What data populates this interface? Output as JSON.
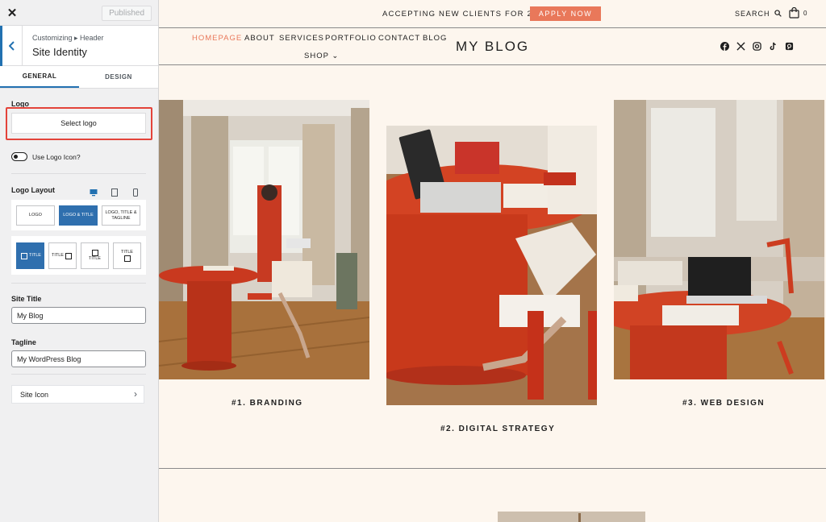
{
  "customizer": {
    "close_label": "✕",
    "published_label": "Published",
    "breadcrumb": "Customizing ▸ Header",
    "section_title": "Site Identity",
    "tabs": [
      {
        "label": "GENERAL"
      },
      {
        "label": "DESIGN"
      }
    ],
    "logo": {
      "label": "Logo",
      "button_label": "Select logo"
    },
    "use_logo_icon": {
      "label": "Use Logo Icon?",
      "enabled": false
    },
    "logo_layout": {
      "label": "Logo Layout",
      "devices": [
        "desktop-icon",
        "tablet-icon",
        "mobile-icon"
      ],
      "options_row1": [
        {
          "label": "LOGO"
        },
        {
          "label": "LOGO & TITLE",
          "selected": true
        },
        {
          "label": "LOGO, TITLE & TAGLINE"
        }
      ],
      "options_row2": [
        {
          "label": "TITLE",
          "selected": true
        },
        {
          "label": "TITLE"
        },
        {
          "label": "TITLE"
        },
        {
          "label": "TITLE"
        }
      ]
    },
    "site_title": {
      "label": "Site Title",
      "value": "My Blog"
    },
    "tagline": {
      "label": "Tagline",
      "value": "My WordPress Blog"
    },
    "site_icon": {
      "label": "Site Icon"
    }
  },
  "preview": {
    "announcement": "ACCEPTING NEW CLIENTS FOR 2026",
    "apply_label": "APPLY NOW",
    "search_label": "SEARCH",
    "cart_count": "0",
    "nav": [
      {
        "label": "HOMEPAGE",
        "current": true
      },
      {
        "label": "ABOUT"
      },
      {
        "label": "SERVICES"
      },
      {
        "label": "PORTFOLIO"
      },
      {
        "label": "CONTACT"
      },
      {
        "label": "BLOG"
      },
      {
        "label": "SHOP ⌄"
      }
    ],
    "site_name": "MY BLOG",
    "social_icons": [
      "facebook-icon",
      "x-icon",
      "instagram-icon",
      "tiktok-icon",
      "pinterest-icon"
    ],
    "cards": [
      {
        "caption": "#1. BRANDING"
      },
      {
        "caption": "#2. DIGITAL STRATEGY"
      },
      {
        "caption": "#3. WEB DESIGN"
      }
    ]
  },
  "colors": {
    "accent": "#e9785a",
    "wp_blue": "#2271b1",
    "highlight": "#e3433a",
    "background": "#fdf6ee"
  }
}
